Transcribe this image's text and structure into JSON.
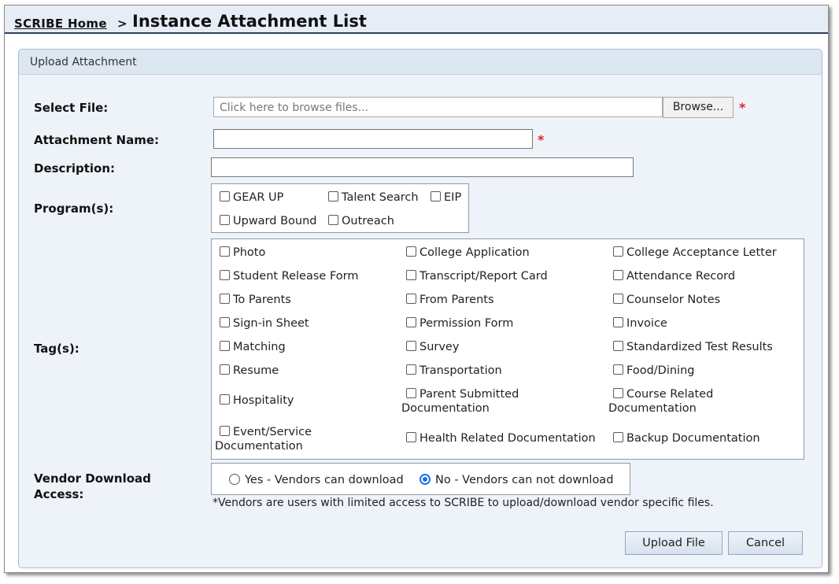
{
  "breadcrumb": {
    "home": "SCRIBE Home",
    "separator": ">",
    "title": "Instance Attachment List"
  },
  "panel": {
    "header": "Upload Attachment"
  },
  "form": {
    "select_file_label": "Select File:",
    "file_placeholder": "Click here to browse files...",
    "browse_label": "Browse...",
    "required_mark": "*",
    "attachment_name_label": "Attachment Name:",
    "attachment_name_value": "",
    "description_label": "Description:",
    "description_value": "",
    "programs_label": "Program(s):",
    "programs": [
      {
        "label": "GEAR UP",
        "checked": false
      },
      {
        "label": "Talent Search",
        "checked": false
      },
      {
        "label": "EIP",
        "checked": false
      },
      {
        "label": "Upward Bound",
        "checked": false
      },
      {
        "label": "Outreach",
        "checked": false
      }
    ],
    "tags_label": "Tag(s):",
    "tags": [
      {
        "label": "Photo"
      },
      {
        "label": "College Application"
      },
      {
        "label": "College Acceptance Letter"
      },
      {
        "label": "Student Release Form"
      },
      {
        "label": "Transcript/Report Card"
      },
      {
        "label": "Attendance Record"
      },
      {
        "label": "To Parents"
      },
      {
        "label": "From Parents"
      },
      {
        "label": "Counselor Notes"
      },
      {
        "label": "Sign-in Sheet"
      },
      {
        "label": "Permission Form"
      },
      {
        "label": "Invoice"
      },
      {
        "label": "Matching"
      },
      {
        "label": "Survey"
      },
      {
        "label": "Standardized Test Results"
      },
      {
        "label": "Resume"
      },
      {
        "label": "Transportation"
      },
      {
        "label": "Food/Dining"
      },
      {
        "label": "Hospitality"
      },
      {
        "label_line1": "Parent Submitted",
        "label_line2": "Documentation"
      },
      {
        "label_line1": "Course Related",
        "label_line2": "Documentation"
      },
      {
        "label_line1": "Event/Service",
        "label_line2": "Documentation"
      },
      {
        "label": "Health Related Documentation"
      },
      {
        "label": "Backup Documentation"
      }
    ],
    "vendor_label_line1": "Vendor Download",
    "vendor_label_line2": "Access:",
    "vendor_options": [
      {
        "label": "Yes - Vendors can download",
        "selected": false
      },
      {
        "label": "No - Vendors can not download",
        "selected": true
      }
    ],
    "vendor_note": "*Vendors are users with limited access to SCRIBE to upload/download vendor specific files."
  },
  "actions": {
    "upload": "Upload File",
    "cancel": "Cancel"
  },
  "colors": {
    "required": "#e0202a",
    "radio_selected": "#1a73e8",
    "title_rule": "#2f3f5f"
  }
}
